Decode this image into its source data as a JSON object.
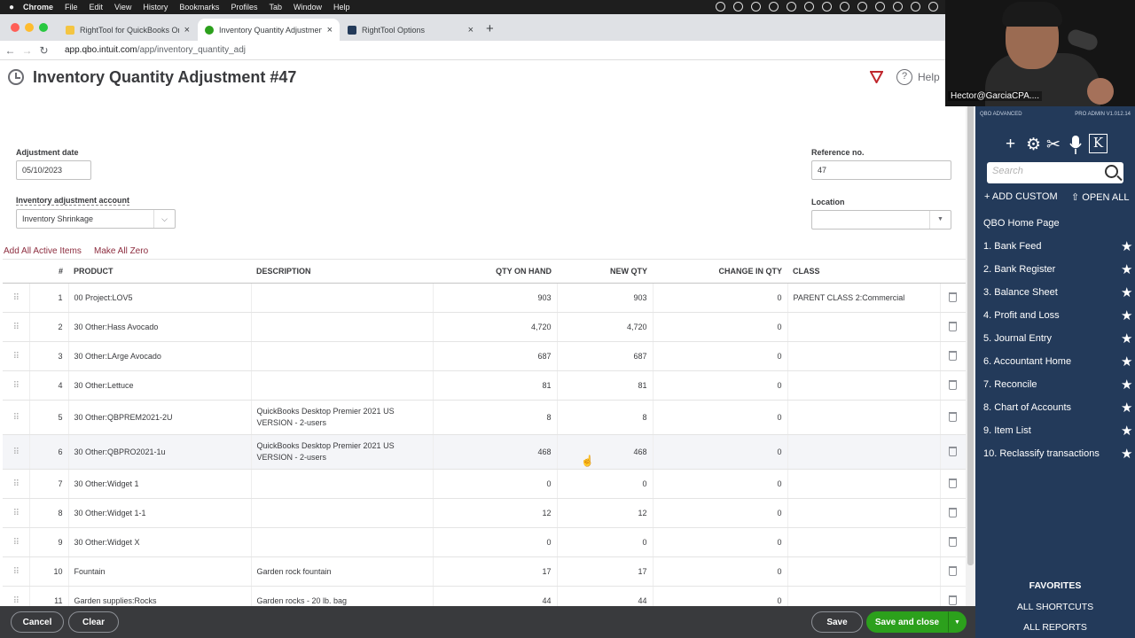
{
  "menubar": {
    "app": "Chrome",
    "items": [
      "File",
      "Edit",
      "View",
      "History",
      "Bookmarks",
      "Profiles",
      "Tab",
      "Window",
      "Help"
    ]
  },
  "tabs": [
    {
      "label": "RightTool for QuickBooks Onli",
      "active": false
    },
    {
      "label": "Inventory Quantity Adjustment",
      "active": true
    },
    {
      "label": "RightTool Options",
      "active": false
    }
  ],
  "address": {
    "host": "app.qbo.intuit.com",
    "path": "/app/inventory_quantity_adj"
  },
  "page": {
    "title": "Inventory Quantity Adjustment #47",
    "help": "Help"
  },
  "form": {
    "date_label": "Adjustment date",
    "date_value": "05/10/2023",
    "account_label": "Inventory adjustment account",
    "account_value": "Inventory Shrinkage",
    "ref_label": "Reference no.",
    "ref_value": "47",
    "location_label": "Location",
    "location_value": ""
  },
  "links": {
    "add_all": "Add All Active Items",
    "make_zero": "Make All Zero"
  },
  "table": {
    "headers": [
      "#",
      "PRODUCT",
      "DESCRIPTION",
      "QTY ON HAND",
      "NEW QTY",
      "CHANGE IN QTY",
      "CLASS"
    ],
    "rows": [
      {
        "n": "1",
        "product": "00 Project:LOV5",
        "desc": "",
        "qoh": "903",
        "new": "903",
        "chg": "0",
        "cls": "PARENT CLASS 2:Commercial"
      },
      {
        "n": "2",
        "product": "30 Other:Hass Avocado",
        "desc": "",
        "qoh": "4,720",
        "new": "4,720",
        "chg": "0",
        "cls": ""
      },
      {
        "n": "3",
        "product": "30 Other:LArge Avocado",
        "desc": "",
        "qoh": "687",
        "new": "687",
        "chg": "0",
        "cls": ""
      },
      {
        "n": "4",
        "product": "30 Other:Lettuce",
        "desc": "",
        "qoh": "81",
        "new": "81",
        "chg": "0",
        "cls": ""
      },
      {
        "n": "5",
        "product": "30 Other:QBPREM2021-2U",
        "desc": "QuickBooks Desktop Premier 2021 US VERSION - 2-users",
        "qoh": "8",
        "new": "8",
        "chg": "0",
        "cls": ""
      },
      {
        "n": "6",
        "product": "30 Other:QBPRO2021-1u",
        "desc": "QuickBooks Desktop Premier 2021 US VERSION - 2-users",
        "qoh": "468",
        "new": "468",
        "chg": "0",
        "cls": ""
      },
      {
        "n": "7",
        "product": "30 Other:Widget 1",
        "desc": "",
        "qoh": "0",
        "new": "0",
        "chg": "0",
        "cls": ""
      },
      {
        "n": "8",
        "product": "30 Other:Widget 1-1",
        "desc": "",
        "qoh": "12",
        "new": "12",
        "chg": "0",
        "cls": ""
      },
      {
        "n": "9",
        "product": "30 Other:Widget X",
        "desc": "",
        "qoh": "0",
        "new": "0",
        "chg": "0",
        "cls": ""
      },
      {
        "n": "10",
        "product": "Fountain",
        "desc": "Garden rock fountain",
        "qoh": "17",
        "new": "17",
        "chg": "0",
        "cls": ""
      },
      {
        "n": "11",
        "product": "Garden supplies:Rocks",
        "desc": "Garden rocks - 20 lb. bag",
        "qoh": "44",
        "new": "44",
        "chg": "0",
        "cls": ""
      }
    ]
  },
  "footer": {
    "cancel": "Cancel",
    "clear": "Clear",
    "save": "Save",
    "save_close": "Save and close"
  },
  "sidebar": {
    "edition": "QBO ADVANCED",
    "version": "PRO ADMIN V1.012.14",
    "search_placeholder": "Search",
    "add_custom": "+ ADD CUSTOM",
    "open_all": "⇧ OPEN ALL",
    "home": "QBO Home Page",
    "items": [
      "1. Bank Feed",
      "2. Bank Register",
      "3. Balance Sheet",
      "4. Profit and Loss",
      "5. Journal Entry",
      "6. Accountant Home",
      "7. Reconcile",
      "8. Chart of Accounts",
      "9. Item List",
      "10. Reclassify transactions"
    ],
    "favorites": "FAVORITES",
    "all_shortcuts": "ALL SHORTCUTS",
    "all_reports": "ALL REPORTS"
  },
  "webcam": {
    "name": "Hector@GarciaCPA...."
  },
  "colors": {
    "accent_link": "#8d2d3f",
    "sidebar_bg": "#233a5a",
    "save_green": "#2ca01c"
  }
}
